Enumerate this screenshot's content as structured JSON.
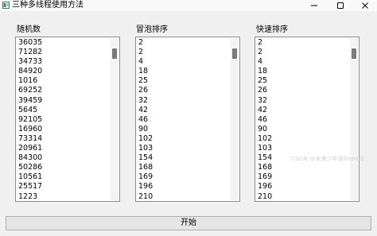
{
  "window": {
    "title": "三种多线程使用方法",
    "minimize_glyph": "—",
    "maximize_glyph": "☐",
    "close_glyph": "✕"
  },
  "panels": [
    {
      "label": "随机数",
      "values": [
        "36035",
        "71282",
        "34733",
        "84920",
        "1016",
        "69252",
        "39459",
        "5645",
        "92105",
        "16960",
        "73314",
        "20961",
        "84300",
        "50286",
        "10561",
        "25517",
        "1223"
      ]
    },
    {
      "label": "冒泡排序",
      "values": [
        "2",
        "2",
        "4",
        "18",
        "25",
        "26",
        "32",
        "42",
        "46",
        "90",
        "102",
        "103",
        "154",
        "168",
        "169",
        "196",
        "210"
      ]
    },
    {
      "label": "快速排序",
      "values": [
        "2",
        "2",
        "4",
        "18",
        "25",
        "26",
        "32",
        "42",
        "46",
        "90",
        "102",
        "103",
        "154",
        "168",
        "169",
        "196",
        "210"
      ]
    }
  ],
  "start_button": {
    "label": "开始"
  },
  "watermark": "CSDN @未来少年是DeHUS",
  "colors": {
    "list_border": "#8c8c8c",
    "thumb": "#7a7a7a",
    "background": "#f0f0f0"
  }
}
